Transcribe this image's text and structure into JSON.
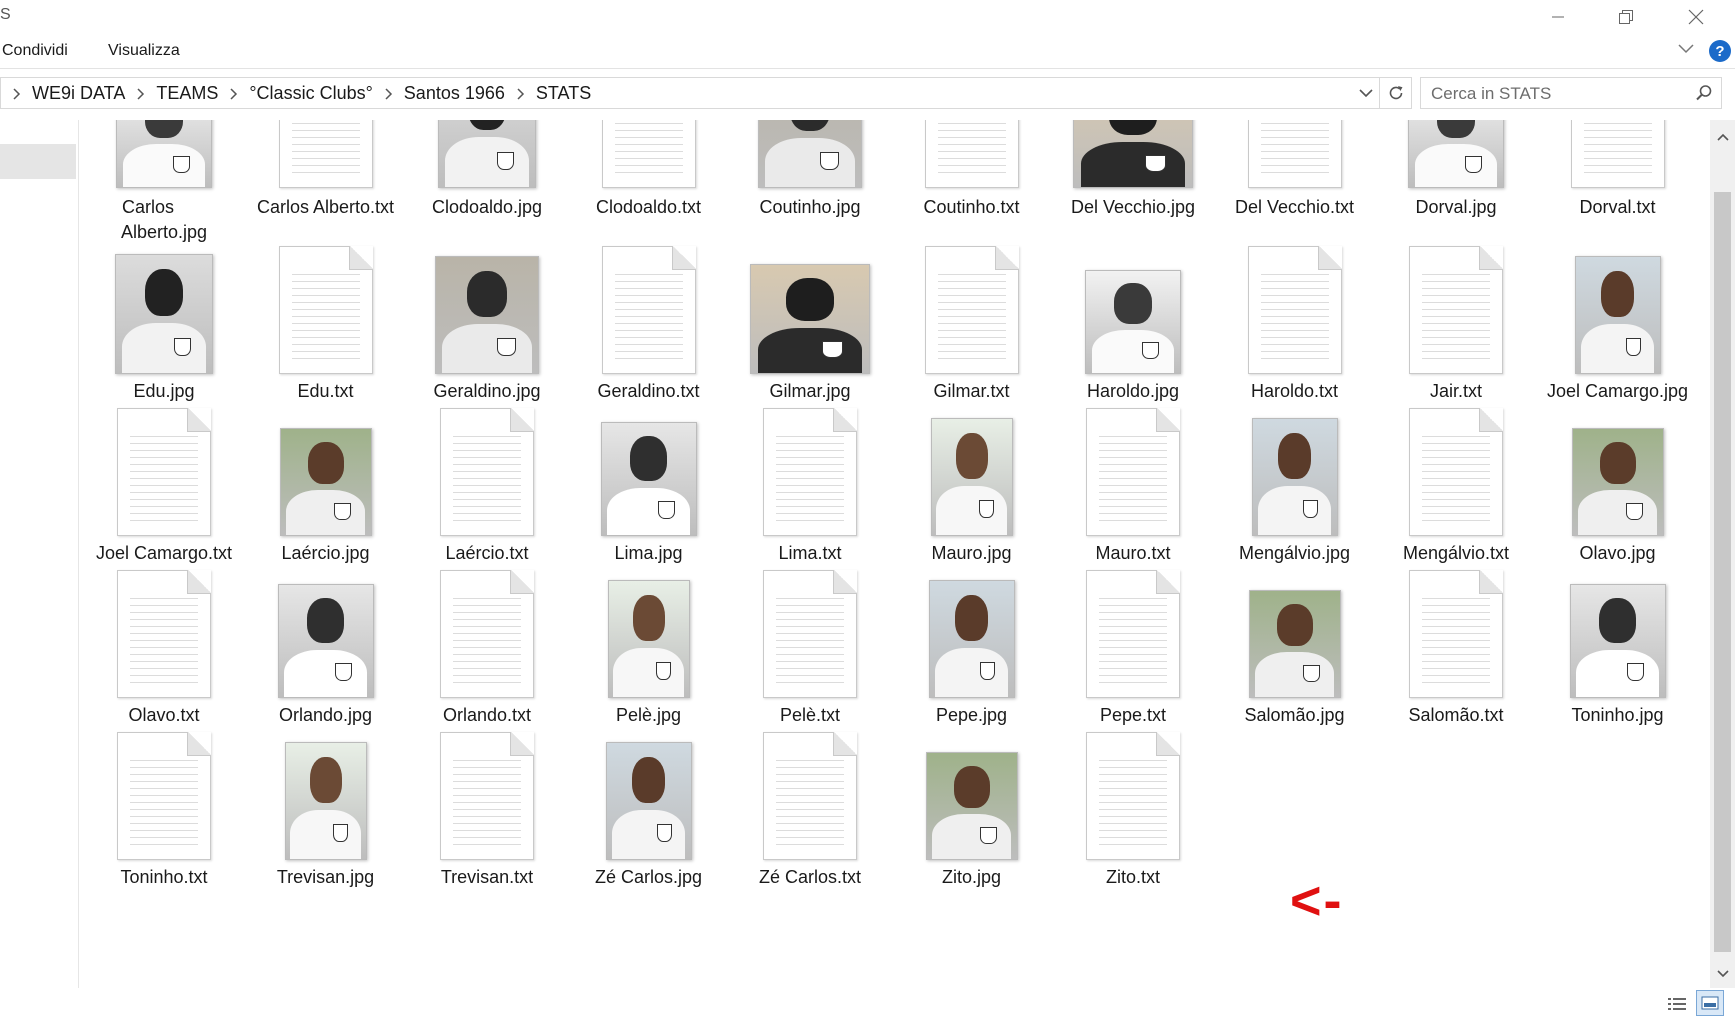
{
  "window": {
    "title_partial": "S"
  },
  "ribbon": {
    "tabs": [
      "Condividi",
      "Visualizza"
    ],
    "help_label": "?"
  },
  "address": {
    "path": [
      "WE9i DATA",
      "TEAMS",
      "°Classic Clubs°",
      "Santos 1966",
      "STATS"
    ]
  },
  "search": {
    "placeholder": "Cerca in STATS"
  },
  "annotation": {
    "text": "<-",
    "color": "#e01010"
  },
  "colors": {
    "accent": "#1b6ac9",
    "selection": "#d9e8f7"
  },
  "files": [
    {
      "name": "Carlos Alberto.jpg",
      "type": "photo",
      "label_lines": [
        "Carlos",
        "Alberto.jpg"
      ]
    },
    {
      "name": "Carlos Alberto.txt",
      "type": "text"
    },
    {
      "name": "Clodoaldo.jpg",
      "type": "photo"
    },
    {
      "name": "Clodoaldo.txt",
      "type": "text"
    },
    {
      "name": "Coutinho.jpg",
      "type": "photo"
    },
    {
      "name": "Coutinho.txt",
      "type": "text"
    },
    {
      "name": "Del Vecchio.jpg",
      "type": "photo"
    },
    {
      "name": "Del Vecchio.txt",
      "type": "text"
    },
    {
      "name": "Dorval.jpg",
      "type": "photo"
    },
    {
      "name": "Dorval.txt",
      "type": "text"
    },
    {
      "name": "Edu.jpg",
      "type": "photo"
    },
    {
      "name": "Edu.txt",
      "type": "text"
    },
    {
      "name": "Geraldino.jpg",
      "type": "photo"
    },
    {
      "name": "Geraldino.txt",
      "type": "text"
    },
    {
      "name": "Gilmar.jpg",
      "type": "photo"
    },
    {
      "name": "Gilmar.txt",
      "type": "text"
    },
    {
      "name": "Haroldo.jpg",
      "type": "photo"
    },
    {
      "name": "Haroldo.txt",
      "type": "text"
    },
    {
      "name": "Jair.txt",
      "type": "text"
    },
    {
      "name": "Joel Camargo.jpg",
      "type": "photo"
    },
    {
      "name": "Joel Camargo.txt",
      "type": "text"
    },
    {
      "name": "Laércio.jpg",
      "type": "photo"
    },
    {
      "name": "Laércio.txt",
      "type": "text"
    },
    {
      "name": "Lima.jpg",
      "type": "photo"
    },
    {
      "name": "Lima.txt",
      "type": "text"
    },
    {
      "name": "Mauro.jpg",
      "type": "photo"
    },
    {
      "name": "Mauro.txt",
      "type": "text"
    },
    {
      "name": "Mengálvio.jpg",
      "type": "photo"
    },
    {
      "name": "Mengálvio.txt",
      "type": "text"
    },
    {
      "name": "Olavo.jpg",
      "type": "photo"
    },
    {
      "name": "Olavo.txt",
      "type": "text"
    },
    {
      "name": "Orlando.jpg",
      "type": "photo"
    },
    {
      "name": "Orlando.txt",
      "type": "text"
    },
    {
      "name": "Pelè.jpg",
      "type": "photo"
    },
    {
      "name": "Pelè.txt",
      "type": "text"
    },
    {
      "name": "Pepe.jpg",
      "type": "photo"
    },
    {
      "name": "Pepe.txt",
      "type": "text"
    },
    {
      "name": "Salomão.jpg",
      "type": "photo"
    },
    {
      "name": "Salomão.txt",
      "type": "text"
    },
    {
      "name": "Toninho.jpg",
      "type": "photo"
    },
    {
      "name": "Toninho.txt",
      "type": "text"
    },
    {
      "name": "Trevisan.jpg",
      "type": "photo"
    },
    {
      "name": "Trevisan.txt",
      "type": "text"
    },
    {
      "name": "Zé Carlos.jpg",
      "type": "photo"
    },
    {
      "name": "Zé Carlos.txt",
      "type": "text"
    },
    {
      "name": "Zito.jpg",
      "type": "photo"
    },
    {
      "name": "Zito.txt",
      "type": "text"
    }
  ]
}
